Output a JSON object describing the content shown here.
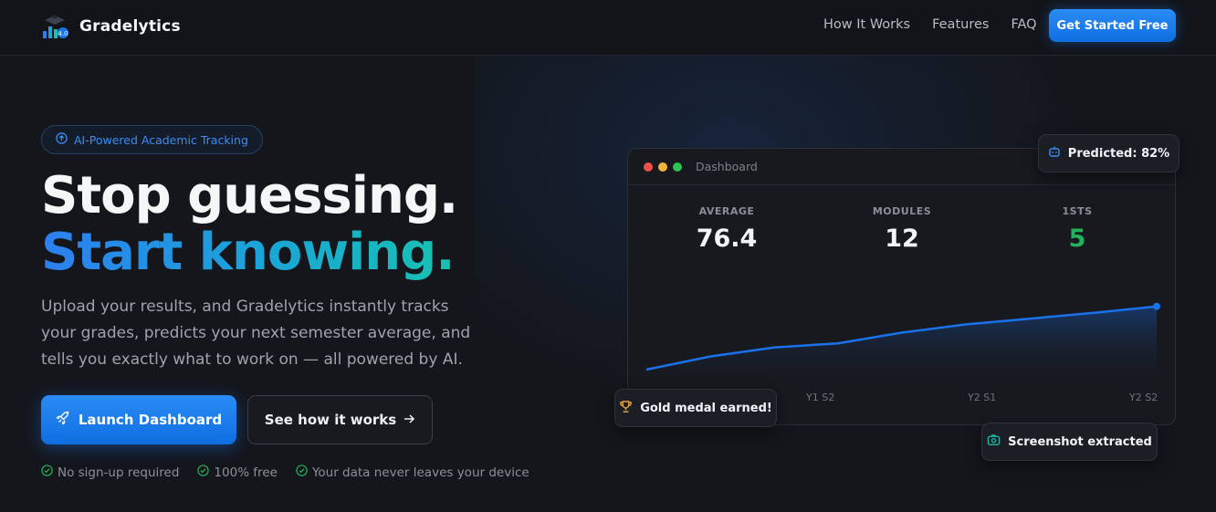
{
  "brand": {
    "name": "Gradelytics"
  },
  "nav": {
    "items": [
      "How It Works",
      "Features",
      "FAQ"
    ],
    "cta": "Get Started Free"
  },
  "hero": {
    "badge": "AI-Powered Academic Tracking",
    "title_line1": "Stop guessing.",
    "title_line2": "Start knowing.",
    "subtitle": "Upload your results, and Gradelytics instantly tracks your grades, predicts your next semester average, and tells you exactly what to work on — all powered by AI.",
    "primary_button": "Launch Dashboard",
    "secondary_button": "See how it works",
    "checks": [
      "No sign-up required",
      "100% free",
      "Your data never leaves your device"
    ]
  },
  "dashboard": {
    "title": "Dashboard",
    "stats": [
      {
        "label": "AVERAGE",
        "value": "76.4",
        "color": "#f2f4f8"
      },
      {
        "label": "MODULES",
        "value": "12",
        "color": "#f2f4f8"
      },
      {
        "label": "1STS",
        "value": "5",
        "color": "#22b25a"
      }
    ],
    "chart_data": {
      "type": "area",
      "x": [
        "Y1 S2",
        "Y2 S1",
        "Y2 S2"
      ],
      "values": [
        0,
        0.16,
        0.27,
        0.32,
        0.45,
        0.55,
        0.62,
        0.69,
        0.77
      ],
      "visible_ticks": [
        "Y1 S2",
        "Y2 S1",
        "Y2 S2"
      ],
      "color": "#1a72ea"
    }
  },
  "chips": {
    "predicted": "Predicted: 82%",
    "gold": "Gold medal earned!",
    "screenshot": "Screenshot extracted"
  },
  "colors": {
    "accent": "#1a78ee",
    "success": "#22b25a",
    "gold": "#e8a13a"
  }
}
